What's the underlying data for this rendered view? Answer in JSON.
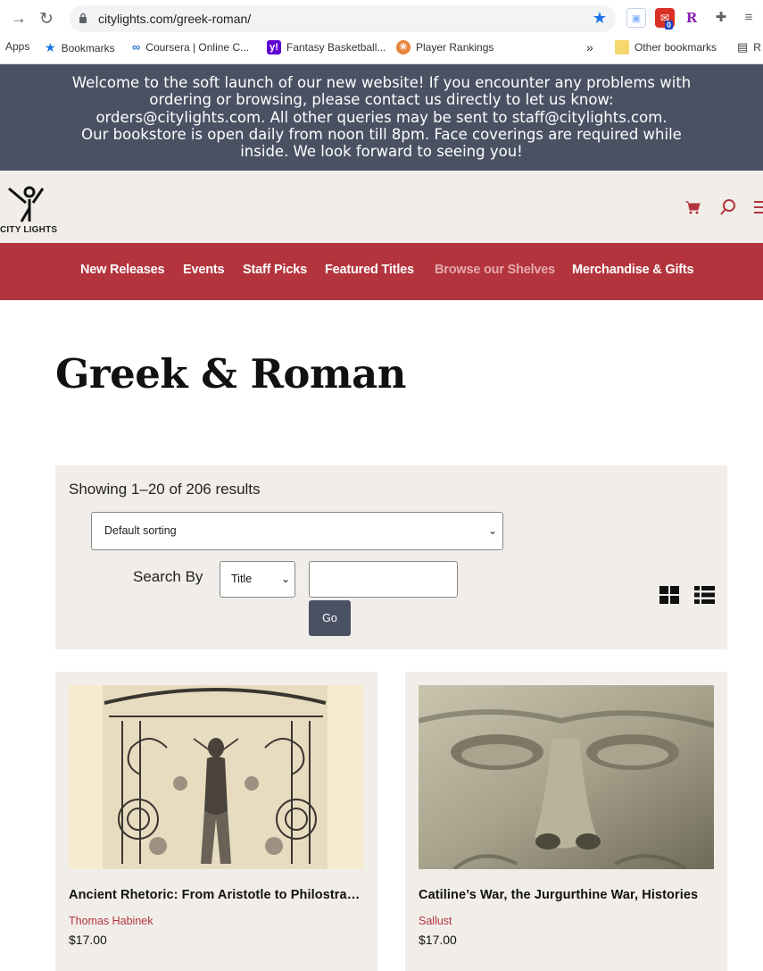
{
  "browser": {
    "url": "citylights.com/greek-roman/",
    "bookmarks": [
      {
        "label": "Apps"
      },
      {
        "label": "Bookmarks"
      },
      {
        "label": "Coursera | Online C..."
      },
      {
        "label": "Fantasy Basketball..."
      },
      {
        "label": "Player Rankings"
      }
    ],
    "overflow": "»",
    "other_bookmarks": "Other bookmarks",
    "reading_list_partial": "R",
    "ext_badge": "0",
    "ext_r_letter": "R"
  },
  "notice": {
    "lines": [
      "Welcome to the soft launch of our new website! If you encounter any problems with ordering or browsing, please contact us directly to let us know: orders@citylights.com. All other queries may be sent to staff@citylights.com.",
      "Our bookstore is open daily from noon till 8pm. Face coverings are required while inside. We look forward to seeing you!"
    ]
  },
  "header": {
    "logo_text": "CITY LIGHTS"
  },
  "nav": {
    "items": [
      {
        "label": "New Releases"
      },
      {
        "label": "Events"
      },
      {
        "label": "Staff Picks"
      },
      {
        "label": "Featured Titles"
      },
      {
        "label": "Browse our Shelves"
      },
      {
        "label": "Merchandise & Gifts"
      }
    ]
  },
  "page": {
    "title": "Greek & Roman"
  },
  "toolbar": {
    "results": "Showing 1–20 of 206 results",
    "sort_value": "Default sorting",
    "search_label": "Search By",
    "search_by_value": "Title",
    "search_value": "",
    "go_label": "Go"
  },
  "products": [
    {
      "title": "Ancient Rhetoric: From Aristotle to Philostratus",
      "author": "Thomas Habinek",
      "price": "$17.00"
    },
    {
      "title": "Catiline’s War, the Jurgurthine War, Histories",
      "author": "Sallust",
      "price": "$17.00"
    }
  ],
  "colors": {
    "brand_red": "#b3343d",
    "banner": "#4a5163",
    "panel": "#f1eeea"
  }
}
